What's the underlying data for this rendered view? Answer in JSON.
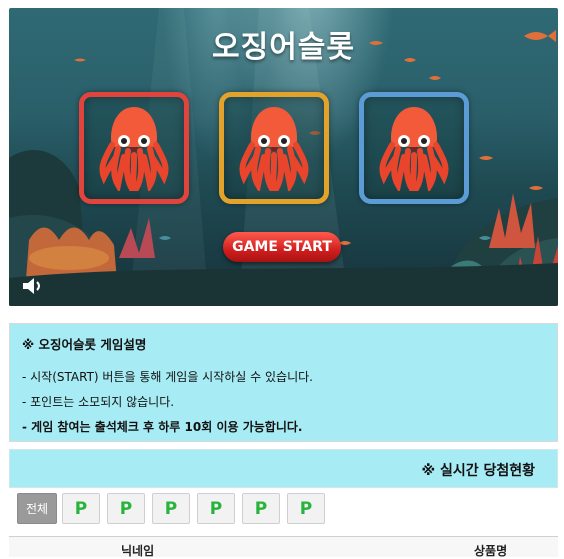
{
  "game": {
    "title": "오징어슬롯",
    "start_button": "GAME START",
    "slots": [
      {
        "symbol": "squid",
        "frame_color": "#e0443c"
      },
      {
        "symbol": "squid",
        "frame_color": "#e3a32a"
      },
      {
        "symbol": "squid",
        "frame_color": "#5b9bd6"
      }
    ],
    "sound_icon": "speaker-icon"
  },
  "description": {
    "heading": "※ 오징어슬롯 게임설명",
    "lines": [
      "- 시작(START) 버튼을 통해 게임을 시작하실 수 있습니다.",
      "- 포인트는 소모되지 않습니다.",
      "- 게임 참여는 출석체크 후 하루 10회 이용 가능합니다."
    ]
  },
  "live": {
    "title": "※ 실시간 당첨현황",
    "filters": [
      "전체",
      "P",
      "P",
      "P",
      "P",
      "P",
      "P"
    ],
    "columns": [
      "닉네임",
      "상품명"
    ]
  },
  "colors": {
    "accent_bg": "#a7ecf4",
    "start_button": "#d11f1f",
    "p_chip": "#28b43c"
  }
}
